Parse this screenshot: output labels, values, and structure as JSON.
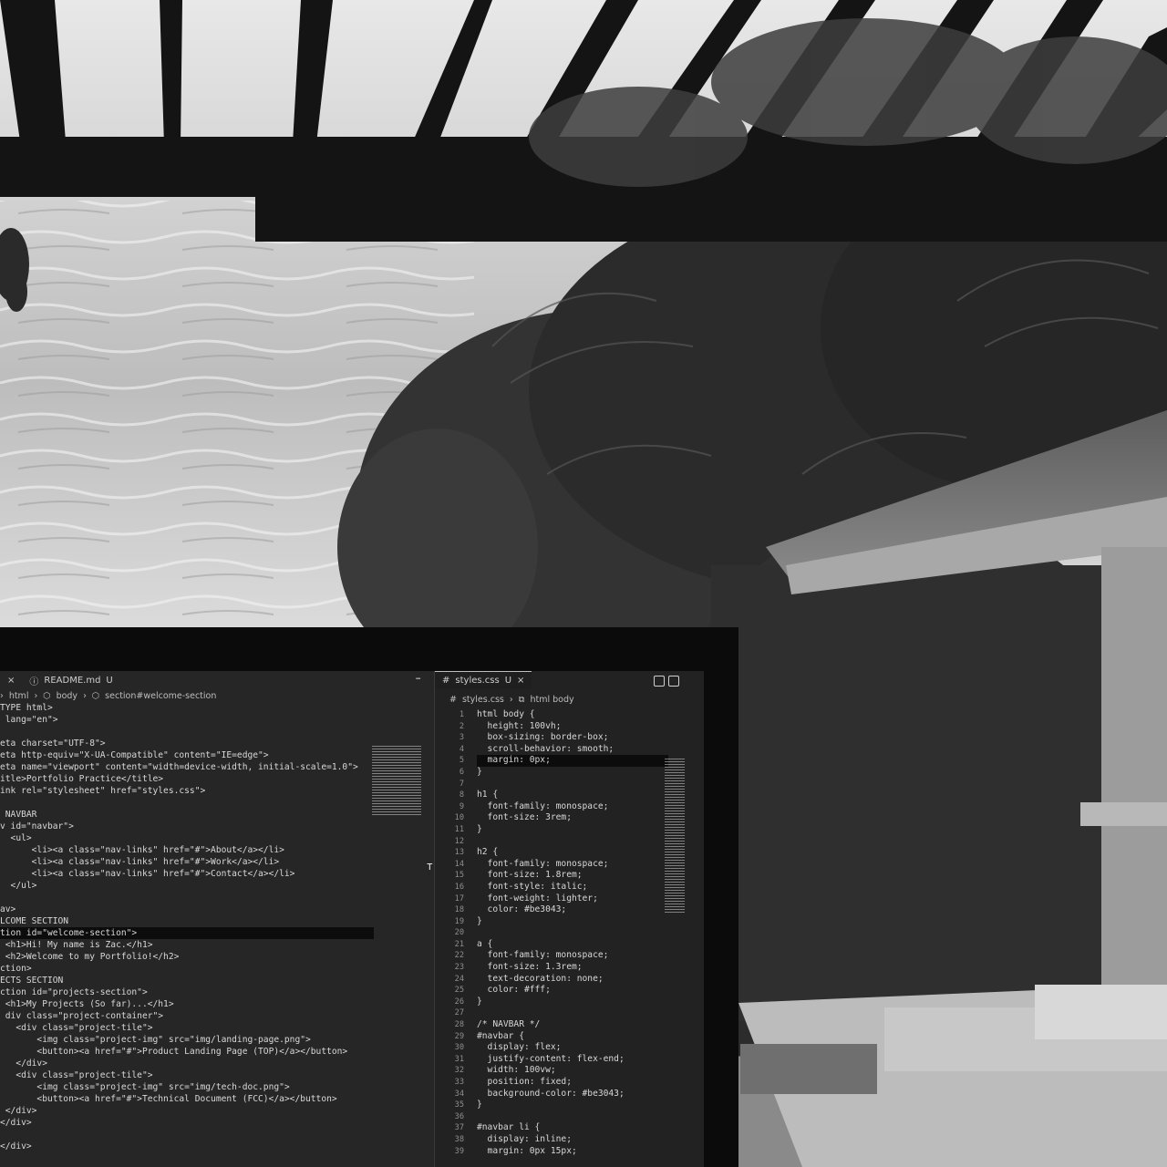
{
  "left_editor": {
    "tabs": [
      {
        "label": "",
        "modifier": "",
        "close": "×"
      },
      {
        "label": "README.md",
        "modifier": "U"
      }
    ],
    "breadcrumb": [
      "html",
      "body",
      "section#welcome-section"
    ],
    "lines": [
      "TYPE html>",
      " lang=\"en\">",
      "",
      "eta charset=\"UTF-8\">",
      "eta http-equiv=\"X-UA-Compatible\" content=\"IE=edge\">",
      "eta name=\"viewport\" content=\"width=device-width, initial-scale=1.0\">",
      "itle>Portfolio Practice</title>",
      "ink rel=\"stylesheet\" href=\"styles.css\">",
      "",
      " NAVBAR",
      "v id=\"navbar\">",
      "  <ul>",
      "      <li><a class=\"nav-links\" href=\"#\">About</a></li>",
      "      <li><a class=\"nav-links\" href=\"#\">Work</a></li>",
      "      <li><a class=\"nav-links\" href=\"#\">Contact</a></li>",
      "  </ul>",
      "",
      "av>",
      "LCOME SECTION",
      "tion id=\"welcome-section\">",
      " <h1>Hi! My name is Zac.</h1>",
      " <h2>Welcome to my Portfolio!</h2>",
      "ction>",
      "ECTS SECTION",
      "ction id=\"projects-section\">",
      " <h1>My Projects (So far)...</h1>",
      " div class=\"project-container\">",
      "   <div class=\"project-tile\">",
      "       <img class=\"project-img\" src=\"img/landing-page.png\">",
      "       <button><a href=\"#\">Product Landing Page (TOP)</a></button>",
      "   </div>",
      "   <div class=\"project-tile\">",
      "       <img class=\"project-img\" src=\"img/tech-doc.png\">",
      "       <button><a href=\"#\">Technical Document (FCC)</a></button>",
      " </div>",
      "</div>",
      "",
      "</div>"
    ]
  },
  "right_editor": {
    "tab": {
      "label": "styles.css",
      "modifier": "U",
      "close": "×"
    },
    "breadcrumb": [
      "styles.css",
      "html body"
    ],
    "line_numbers": [
      "1",
      "2",
      "3",
      "4",
      "5",
      "6",
      "7",
      "8",
      "9",
      "10",
      "11",
      "12",
      "13",
      "14",
      "15",
      "16",
      "17",
      "18",
      "19",
      "20",
      "21",
      "22",
      "23",
      "24",
      "25",
      "26",
      "27",
      "28",
      "29",
      "30",
      "31",
      "32",
      "33",
      "34",
      "35",
      "36",
      "37",
      "38",
      "39"
    ],
    "lines": [
      "html body {",
      "  height: 100vh;",
      "  box-sizing: border-box;",
      "  scroll-behavior: smooth;",
      "  margin: 0px;",
      "}",
      "",
      "h1 {",
      "  font-family: monospace;",
      "  font-size: 3rem;",
      "}",
      "",
      "h2 {",
      "  font-family: monospace;",
      "  font-size: 1.8rem;",
      "  font-style: italic;",
      "  font-weight: lighter;",
      "  color: #be3043;",
      "}",
      "",
      "a {",
      "  font-family: monospace;",
      "  font-size: 1.3rem;",
      "  text-decoration: none;",
      "  color: #fff;",
      "}",
      "",
      "/* NAVBAR */",
      "#navbar {",
      "  display: flex;",
      "  justify-content: flex-end;",
      "  width: 100vw;",
      "  position: fixed;",
      "  background-color: #be3043;",
      "}",
      "",
      "#navbar li {",
      "  display: inline;",
      "  margin: 0px 15px;"
    ]
  },
  "colors": {
    "sky": "#cfcfcf",
    "foliage": "#2e2e2e",
    "pergola": "#111111",
    "editor_bg": "#262626"
  }
}
